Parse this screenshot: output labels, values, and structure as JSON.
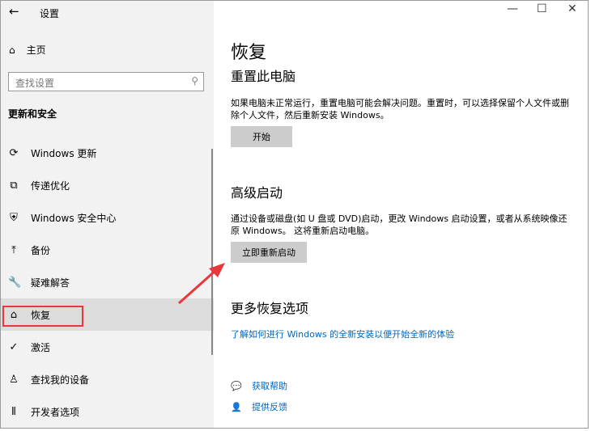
{
  "window": {
    "title": "设置",
    "minimize": "—",
    "maximize": "☐",
    "close": "✕"
  },
  "sidebar": {
    "home": "主页",
    "search_placeholder": "查找设置",
    "section": "更新和安全",
    "items": [
      {
        "label": "Windows 更新",
        "icon": "⟳"
      },
      {
        "label": "传递优化",
        "icon": "⧉"
      },
      {
        "label": "Windows 安全中心",
        "icon": "⛨"
      },
      {
        "label": "备份",
        "icon": "⤒"
      },
      {
        "label": "疑难解答",
        "icon": "🔧"
      },
      {
        "label": "恢复",
        "icon": "⌂"
      },
      {
        "label": "激活",
        "icon": "✓"
      },
      {
        "label": "查找我的设备",
        "icon": "♙"
      },
      {
        "label": "开发者选项",
        "icon": "⫴"
      }
    ],
    "selected": "恢复"
  },
  "main": {
    "title": "恢复",
    "reset": {
      "heading": "重置此电脑",
      "desc": "如果电脑未正常运行，重置电脑可能会解决问题。重置时，可以选择保留个人文件或删除个人文件，然后重新安装 Windows。",
      "button": "开始"
    },
    "advanced": {
      "heading": "高级启动",
      "desc": "通过设备或磁盘(如 U 盘或 DVD)启动，更改 Windows 启动设置，或者从系统映像还原 Windows。 这将重新启动电脑。",
      "button": "立即重新启动"
    },
    "more": {
      "heading": "更多恢复选项",
      "link": "了解如何进行 Windows 的全新安装以便开始全新的体验"
    },
    "help": {
      "get_help": "获取帮助",
      "feedback": "提供反馈"
    }
  },
  "colors": {
    "accent": "#0067c0",
    "highlight": "#e8383b"
  }
}
